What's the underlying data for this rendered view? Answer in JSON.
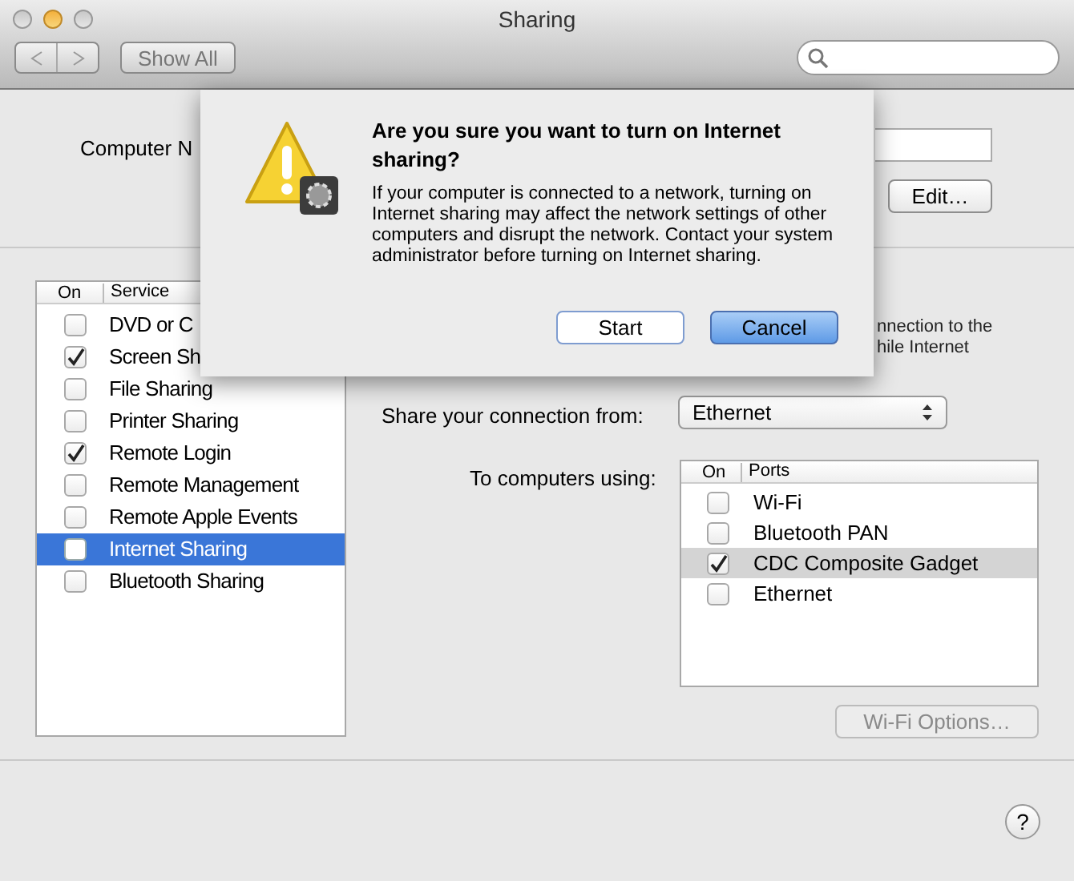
{
  "window": {
    "title": "Sharing"
  },
  "toolbar": {
    "show_all": "Show All"
  },
  "computer_name": {
    "label": "Computer N",
    "edit_button": "Edit…"
  },
  "services": {
    "columns": [
      "On",
      "Service"
    ],
    "items": [
      {
        "label": "DVD or C",
        "checked": false,
        "selected": false
      },
      {
        "label": "Screen Sh",
        "checked": true,
        "selected": false
      },
      {
        "label": "File Sharing",
        "checked": false,
        "selected": false
      },
      {
        "label": "Printer Sharing",
        "checked": false,
        "selected": false
      },
      {
        "label": "Remote Login",
        "checked": true,
        "selected": false
      },
      {
        "label": "Remote Management",
        "checked": false,
        "selected": false
      },
      {
        "label": "Remote Apple Events",
        "checked": false,
        "selected": false
      },
      {
        "label": "Internet Sharing",
        "checked": false,
        "selected": true
      },
      {
        "label": "Bluetooth Sharing",
        "checked": false,
        "selected": false
      }
    ]
  },
  "internet_sharing": {
    "description_lines": [
      "nnection to the",
      "hile Internet"
    ],
    "share_from_label": "Share your connection from:",
    "share_from_value": "Ethernet",
    "to_computers_label": "To computers using:",
    "ports": {
      "columns": [
        "On",
        "Ports"
      ],
      "items": [
        {
          "label": "Wi-Fi",
          "checked": false,
          "selected": false
        },
        {
          "label": "Bluetooth PAN",
          "checked": false,
          "selected": false
        },
        {
          "label": "CDC Composite Gadget",
          "checked": true,
          "selected": true
        },
        {
          "label": "Ethernet",
          "checked": false,
          "selected": false
        }
      ]
    },
    "wifi_options": {
      "label": "Wi-Fi Options…",
      "disabled": true
    }
  },
  "help_button": "?",
  "dialog": {
    "title": "Are you sure you want to turn on Internet sharing?",
    "message": "If your computer is connected to a network, turning on Internet sharing may affect the network settings of other computers and disrupt the network. Contact your system administrator before turning on Internet sharing.",
    "buttons": [
      {
        "label": "Start",
        "default": false
      },
      {
        "label": "Cancel",
        "default": true
      }
    ]
  }
}
